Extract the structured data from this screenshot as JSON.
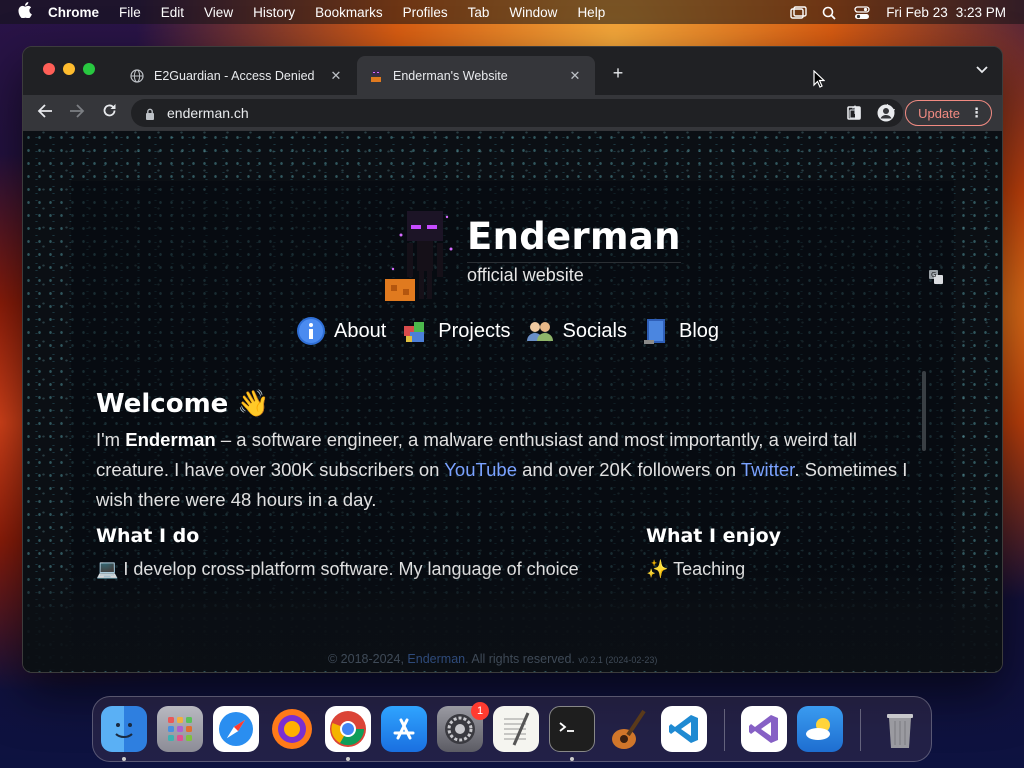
{
  "menubar": {
    "app_name": "Chrome",
    "items": [
      "File",
      "Edit",
      "View",
      "History",
      "Bookmarks",
      "Profiles",
      "Tab",
      "Window",
      "Help"
    ],
    "date": "Fri Feb 23",
    "time": "3:23 PM"
  },
  "browser": {
    "tabs": [
      {
        "title": "E2Guardian - Access Denied",
        "favicon": "globe-icon",
        "active": false
      },
      {
        "title": "Enderman's Website",
        "favicon": "site-icon",
        "active": true
      }
    ],
    "url": "enderman.ch",
    "update_label": "Update"
  },
  "site": {
    "title": "Enderman",
    "subtitle": "official website",
    "nav": [
      {
        "label": "About",
        "icon": "info-icon"
      },
      {
        "label": "Projects",
        "icon": "projects-icon"
      },
      {
        "label": "Socials",
        "icon": "people-icon"
      },
      {
        "label": "Blog",
        "icon": "blog-icon"
      }
    ],
    "welcome_heading": "Welcome 👋",
    "intro": {
      "p1": "I'm ",
      "name": "Enderman",
      "p2": " – a software engineer, a malware enthusiast and most importantly, a weird tall creature. I have over 300K subscribers on ",
      "youtube": "YouTube",
      "p3": " and over 20K followers on ",
      "twitter": "Twitter",
      "p4": ". Sometimes I wish there were 48 hours in a day."
    },
    "what_i_do": {
      "heading": "What I do",
      "line": "💻 I develop cross-platform software. My language of choice"
    },
    "what_i_enjoy": {
      "heading": "What I enjoy",
      "line": "✨ Teaching"
    },
    "footer": {
      "text_a": "© 2018-2024, ",
      "name": "Enderman",
      "text_b": ". All rights reserved.",
      "version": "v0.2.1 (2024-02-23)"
    }
  },
  "dock": {
    "apps": [
      "Finder",
      "Launchpad",
      "Safari",
      "Firefox",
      "Chrome",
      "App Store",
      "System Settings",
      "TextEdit",
      "Terminal",
      "GarageBand",
      "Visual Studio Code",
      "Visual Studio",
      "Weather",
      "Trash"
    ],
    "settings_badge": "1"
  },
  "colors": {
    "accent_link": "#7aa2ff",
    "update_border": "#f28b82"
  }
}
